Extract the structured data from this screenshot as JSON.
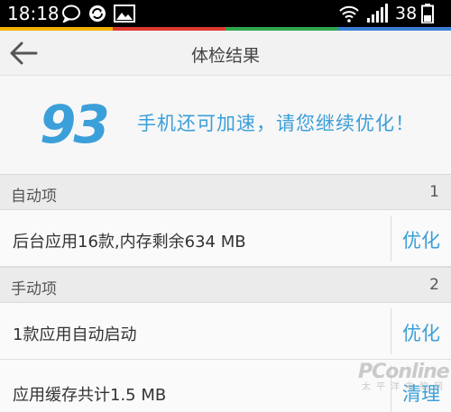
{
  "status_bar": {
    "time": "18:18",
    "battery": "38",
    "icons": [
      "chat-bubble-icon",
      "sync-icon",
      "image-icon",
      "wifi-icon",
      "signal-icon",
      "battery-icon"
    ]
  },
  "color_strip": [
    "#f3b000",
    "#dd3a2e",
    "#2fa84f",
    "#3b7fd4"
  ],
  "header": {
    "back_icon": "back-arrow-icon",
    "title": "体检结果"
  },
  "score": {
    "value": "93",
    "message": "手机还可加速，请您继续优化！"
  },
  "sections": [
    {
      "label": "自动项",
      "count": "1",
      "items": [
        {
          "text": "后台应用16款,内存剩余634 MB",
          "action": "优化"
        }
      ]
    },
    {
      "label": "手动项",
      "count": "2",
      "items": [
        {
          "text": "1款应用自动启动",
          "action": "优化"
        },
        {
          "text": "应用缓存共计1.5 MB",
          "action": "清理"
        }
      ]
    }
  ],
  "watermark": {
    "main": "PConline",
    "sub": "太平洋电脑网"
  },
  "colors": {
    "accent": "#3b9fd9",
    "status_bar": "#000000",
    "section_bg": "#ebebeb",
    "row_bg": "#fafafa"
  }
}
